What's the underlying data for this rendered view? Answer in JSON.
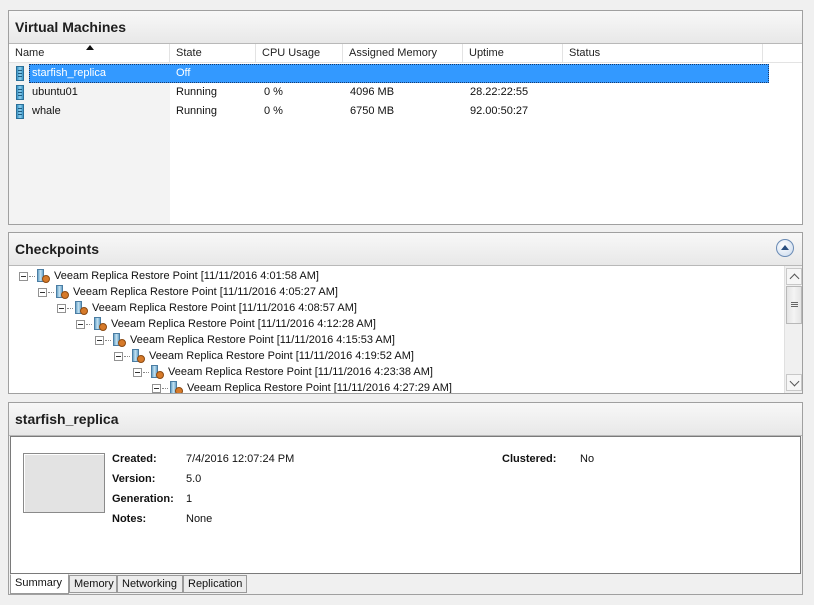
{
  "vm_panel": {
    "title": "Virtual Machines",
    "columns": [
      "Name",
      "State",
      "CPU Usage",
      "Assigned Memory",
      "Uptime",
      "Status"
    ],
    "rows": [
      {
        "name": "starfish_replica",
        "state": "Off",
        "cpu": "",
        "memory": "",
        "uptime": "",
        "status": "",
        "selected": true
      },
      {
        "name": "ubuntu01",
        "state": "Running",
        "cpu": "0 %",
        "memory": "4096 MB",
        "uptime": "28.22:22:55",
        "status": ""
      },
      {
        "name": "whale",
        "state": "Running",
        "cpu": "0 %",
        "memory": "6750 MB",
        "uptime": "92.00:50:27",
        "status": ""
      }
    ]
  },
  "checkpoints_panel": {
    "title": "Checkpoints",
    "items": [
      "Veeam Replica Restore Point [11/11/2016 4:01:58 AM]",
      "Veeam Replica Restore Point [11/11/2016 4:05:27 AM]",
      "Veeam Replica Restore Point [11/11/2016 4:08:57 AM]",
      "Veeam Replica Restore Point [11/11/2016 4:12:28 AM]",
      "Veeam Replica Restore Point [11/11/2016 4:15:53 AM]",
      "Veeam Replica Restore Point [11/11/2016 4:19:52 AM]",
      "Veeam Replica Restore Point [11/11/2016 4:23:38 AM]",
      "Veeam Replica Restore Point [11/11/2016 4:27:29 AM]"
    ]
  },
  "details_panel": {
    "title": "starfish_replica",
    "created_label": "Created:",
    "created_value": "7/4/2016 12:07:24 PM",
    "version_label": "Version:",
    "version_value": "5.0",
    "generation_label": "Generation:",
    "generation_value": "1",
    "notes_label": "Notes:",
    "notes_value": "None",
    "clustered_label": "Clustered:",
    "clustered_value": "No",
    "tabs": [
      "Summary",
      "Memory",
      "Networking",
      "Replication"
    ]
  },
  "icons": {
    "vm": "vm-server-icon",
    "checkpoint": "checkpoint-icon",
    "collapse": "collapse-up-icon",
    "sort": "sort-ascending-icon"
  },
  "colors": {
    "selection": "#3399ff",
    "panel_header": "#e8e8e8"
  }
}
